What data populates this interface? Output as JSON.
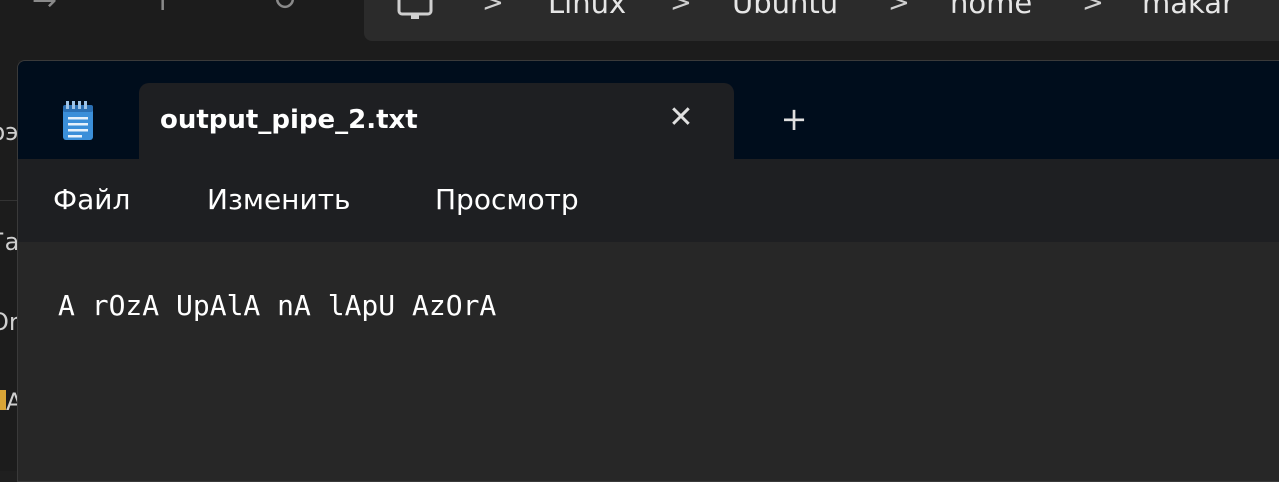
{
  "explorer": {
    "breadcrumbs": [
      "Linux",
      "Ubuntu",
      "home",
      "makar"
    ],
    "separator": ">",
    "nav_icons": {
      "forward": "→",
      "up": "↑",
      "refresh": "↻"
    },
    "side_fragments": [
      "рэ",
      "Га",
      "Or",
      "A"
    ]
  },
  "notepad": {
    "tab_title": "output_pipe_2.txt",
    "close_glyph": "✕",
    "new_tab_glyph": "+",
    "menu": {
      "file": "Файл",
      "edit": "Изменить",
      "view": "Просмотр"
    },
    "content": "A rOzA UpAlA nA lApU AzOrA"
  }
}
